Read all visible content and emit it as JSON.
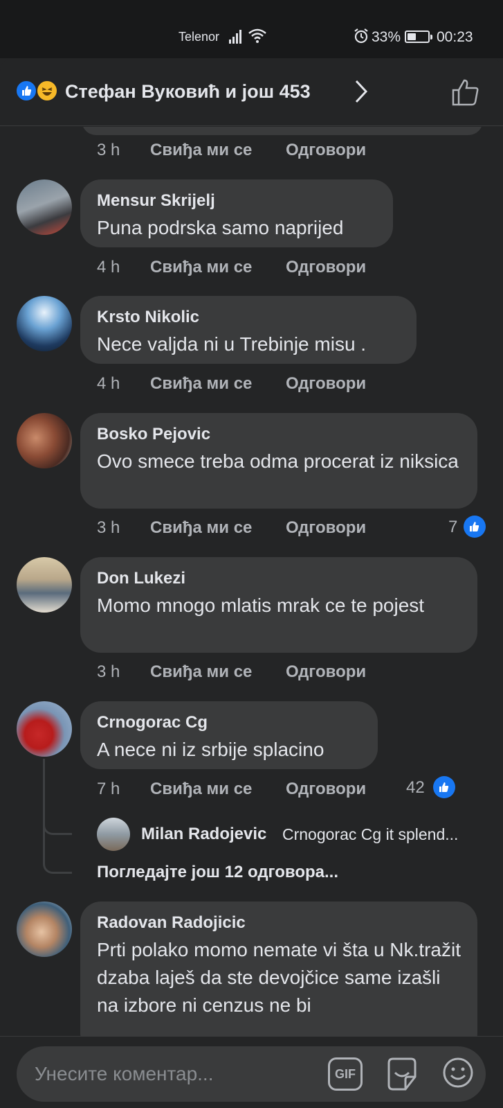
{
  "status_bar": {
    "carrier": "Telenor",
    "battery": "33%",
    "time": "00:23"
  },
  "header": {
    "title": "Стефан Вуковић и још 453",
    "reactions": [
      "like",
      "haha"
    ]
  },
  "labels": {
    "like": "Свиђа ми се",
    "reply": "Одговори"
  },
  "previous_comment": {
    "time": "3 h"
  },
  "comments": [
    {
      "name": "Mensur Skrijelj",
      "text": "Puna podrska samo naprijed",
      "time": "4 h",
      "likes": ""
    },
    {
      "name": "Krsto Nikolic",
      "text": "Nece valjda ni u Trebinje misu .",
      "time": "4 h",
      "likes": ""
    },
    {
      "name": "Bosko Pejovic",
      "text": "Ovo smece treba odma procerat iz niksica",
      "time": "3 h",
      "likes": "7"
    },
    {
      "name": "Don Lukezi",
      "text": "Momo mnogo mlatis mrak ce te pojest",
      "time": "3 h",
      "likes": ""
    },
    {
      "name": "Crnogorac Cg",
      "text": "A nece ni iz srbije splacino",
      "time": "7 h",
      "likes": "42"
    },
    {
      "name": "Radovan Radojicic",
      "text": "Prti polako momo nemate vi šta u Nk.tražit dzaba laješ da ste devojčice same izašli na izbore ni cenzus ne bi",
      "time": "",
      "likes": ""
    }
  ],
  "reply_preview": {
    "name": "Milan Radojevic",
    "text": "Crnogorac Cg it splend...",
    "more": "Погледајте још 12 одговора..."
  },
  "composer": {
    "placeholder": "Унесите коментар...",
    "gif_label": "GIF"
  }
}
